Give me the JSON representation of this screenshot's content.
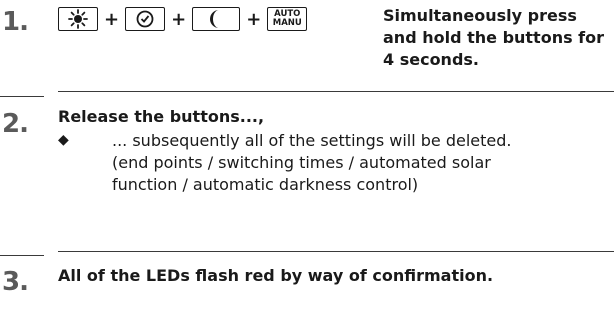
{
  "steps": [
    {
      "number": "1.",
      "instruction": "Simultaneously press and hold the buttons for 4 seconds.",
      "buttons": [
        {
          "icon": "sun-icon"
        },
        {
          "icon": "clock-icon"
        },
        {
          "icon": "moon-icon"
        },
        {
          "icon": "auto-manu-icon",
          "label_top": "AUTO",
          "label_bottom": "MANU"
        }
      ],
      "plus": "+"
    },
    {
      "number": "2.",
      "heading": "Release the buttons...,",
      "bullet": "◆",
      "detail": "... subsequently all of the settings will be deleted.",
      "note": "(end points / switching times / automated solar function / automatic darkness control)"
    },
    {
      "number": "3.",
      "text": "All of the LEDs flash red by way of confirmation."
    }
  ]
}
